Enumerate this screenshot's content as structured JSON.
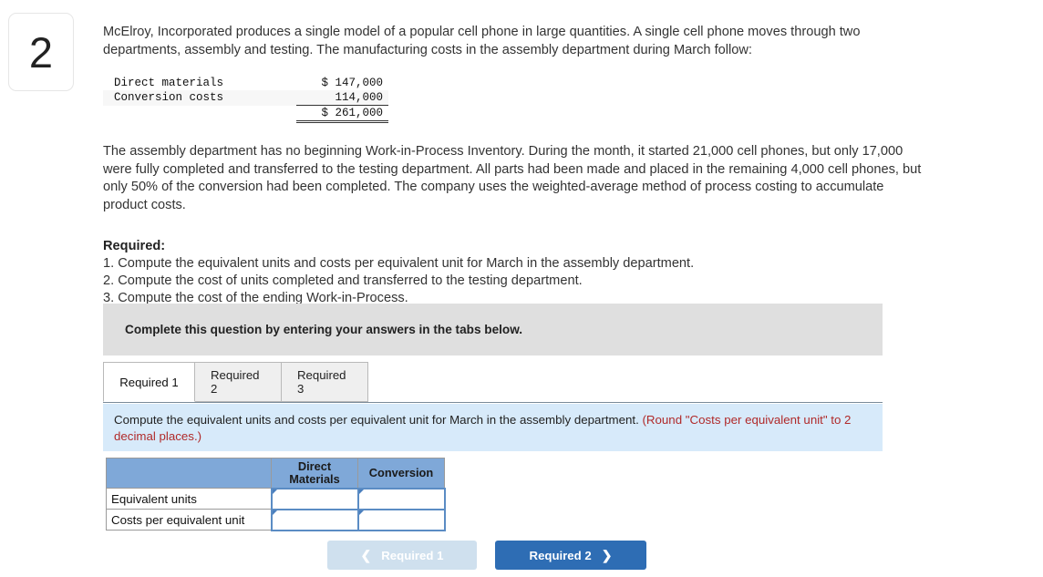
{
  "question": {
    "number": "2",
    "intro": "McElroy, Incorporated produces a single model of a popular cell phone in large quantities. A single cell phone moves through two departments, assembly and testing. The manufacturing costs in the assembly department during March follow:",
    "body": "The assembly department has no beginning Work-in-Process Inventory. During the month, it started 21,000 cell phones, but only 17,000 were fully completed and transferred to the testing department. All parts had been made and placed in the remaining 4,000 cell phones, but only 50% of the conversion had been completed. The company uses the weighted-average method of process costing to accumulate product costs."
  },
  "cost_table": {
    "rows": [
      {
        "label": "Direct materials",
        "amount": "$ 147,000"
      },
      {
        "label": "Conversion costs",
        "amount": "114,000"
      }
    ],
    "total": "$ 261,000"
  },
  "required": {
    "heading": "Required:",
    "items": [
      "1. Compute the equivalent units and costs per equivalent unit for March in the assembly department.",
      "2. Compute the cost of units completed and transferred to the testing department.",
      "3. Compute the cost of the ending Work-in-Process."
    ]
  },
  "banner": {
    "text": "Complete this question by entering your answers in the tabs below."
  },
  "tabs": [
    {
      "label": "Required 1",
      "active": true
    },
    {
      "label": "Required 2",
      "active": false
    },
    {
      "label": "Required 3",
      "active": false
    }
  ],
  "instruction": {
    "main": "Compute the equivalent units and costs per equivalent unit for March in the assembly department.",
    "note": "(Round \"Costs per equivalent unit\" to 2 decimal places.)"
  },
  "answer_table": {
    "corner_header": "",
    "columns": [
      "Direct Materials",
      "Conversion"
    ],
    "column_lines": [
      [
        "Direct",
        "Materials"
      ],
      [
        "Conversion"
      ]
    ],
    "rows": [
      {
        "label": "Equivalent units",
        "direct_materials": "",
        "conversion": ""
      },
      {
        "label": "Costs per equivalent unit",
        "direct_materials": "",
        "conversion": ""
      }
    ]
  },
  "navigation": {
    "prev_label": "Required 1",
    "next_label": "Required 2",
    "prev_icon": "chevron-left-icon",
    "next_icon": "chevron-right-icon"
  },
  "colors": {
    "header_blue": "#7fa8d8",
    "panel_blue": "#d7eafa",
    "banner_grey": "#dfdfdf",
    "button_blue": "#2e6db4",
    "button_disabled": "#cfe0ee",
    "note_red": "#b02a2a"
  }
}
